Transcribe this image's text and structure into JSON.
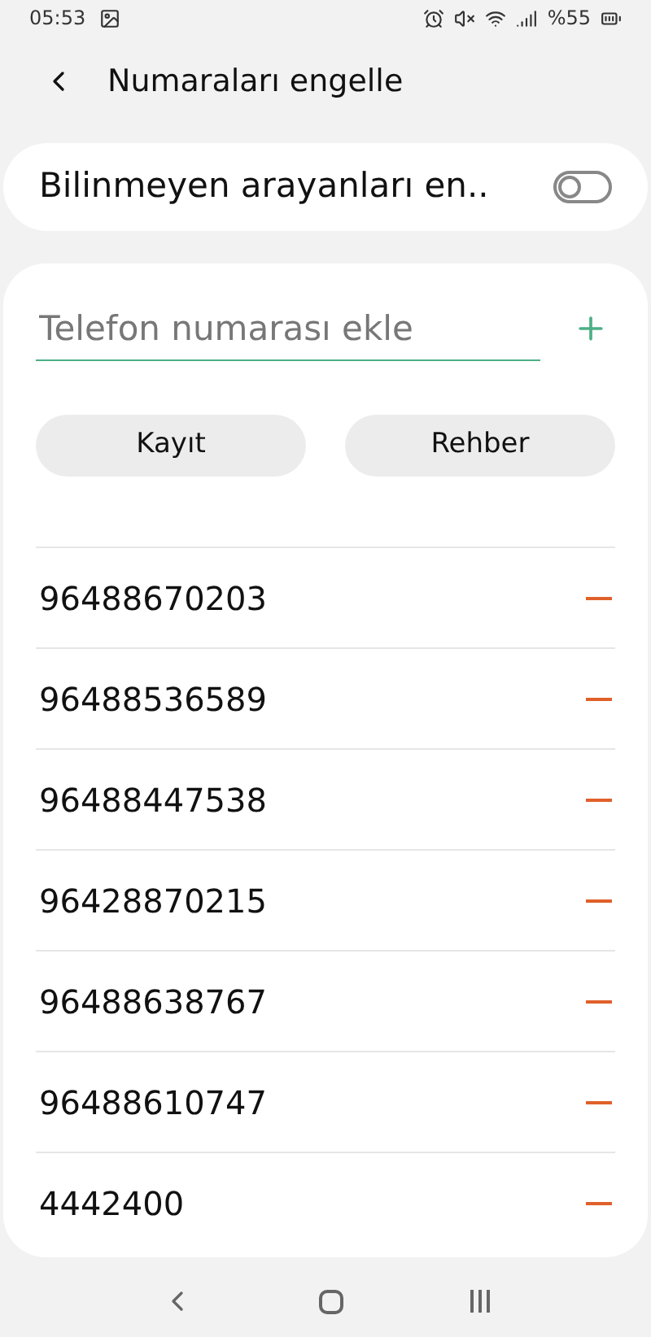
{
  "status_bar": {
    "time": "05:53",
    "battery": "%55"
  },
  "header": {
    "title": "Numaraları engelle"
  },
  "unknown_callers": {
    "label": "Bilinmeyen arayanları en..",
    "on": false
  },
  "add_number": {
    "placeholder": "Telefon numarası ekle"
  },
  "buttons": [
    "Kayıt",
    "Rehber"
  ],
  "blocked_numbers": [
    {
      "number": "96488670203"
    },
    {
      "number": "96488536589"
    },
    {
      "number": "96488447538"
    },
    {
      "number": "96428870215"
    },
    {
      "number": "96488638767"
    },
    {
      "number": "96488610747"
    },
    {
      "number": "4442400"
    }
  ]
}
